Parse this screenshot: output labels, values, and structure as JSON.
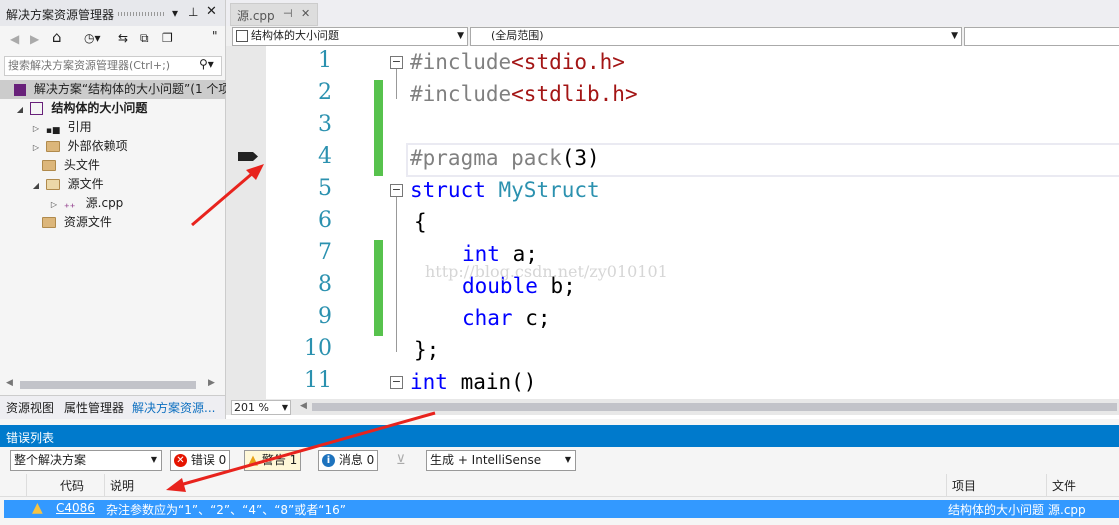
{
  "solution_explorer": {
    "title": "解决方案资源管理器",
    "pin_glyph": "▾ ⊥",
    "close_glyph": "✕",
    "search_placeholder": "搜索解决方案资源管理器(Ctrl+;)",
    "tree": {
      "solution": "解决方案“结构体的大小问题”(1 个项",
      "project": "结构体的大小问题",
      "references": "引用",
      "external_deps": "外部依赖项",
      "header_files": "头文件",
      "source_files": "源文件",
      "source_cpp": "源.cpp",
      "resource_files": "资源文件"
    },
    "bottom_tabs": [
      "资源视图",
      "属性管理器",
      "解决方案资源..."
    ]
  },
  "editor": {
    "tab_label": "源.cpp",
    "tab_pin": "⊣",
    "tab_close": "✕",
    "nav_project": "结构体的大小问题",
    "nav_scope": "(全局范围)",
    "zoom": "201 %",
    "watermark": "http://blog.csdn.net/zy010101",
    "line_numbers": [
      "1",
      "2",
      "3",
      "4",
      "5",
      "6",
      "7",
      "8",
      "9",
      "10",
      "11"
    ],
    "code": {
      "l1a": "#include",
      "l1b": "<stdio.h>",
      "l2a": "#include",
      "l2b": "<stdlib.h>",
      "l4a": "#pragma pack",
      "l4b": "(3)",
      "l5a": "struct",
      "l5b": "MyStruct",
      "l6": "{",
      "l7a": "int",
      "l7b": " a;",
      "l8a": "double",
      "l8b": " b;",
      "l9a": "char",
      "l9b": " c;",
      "l10": "};",
      "l11a": "int",
      "l11b": " main()"
    }
  },
  "error_list": {
    "title": "错误列表",
    "scope": "整个解决方案",
    "errors_btn": "错误 0",
    "warnings_btn": "警告 1",
    "messages_btn": "消息 0",
    "build_filter": "生成 + IntelliSense",
    "headers": {
      "code": "代码",
      "desc": "说明",
      "project": "项目",
      "file": "文件"
    },
    "rows": [
      {
        "code": "C4086",
        "desc": "杂注参数应为“1”、“2”、“4”、“8”或者“16”",
        "project": "结构体的大小问题",
        "file": "源.cpp"
      }
    ]
  }
}
